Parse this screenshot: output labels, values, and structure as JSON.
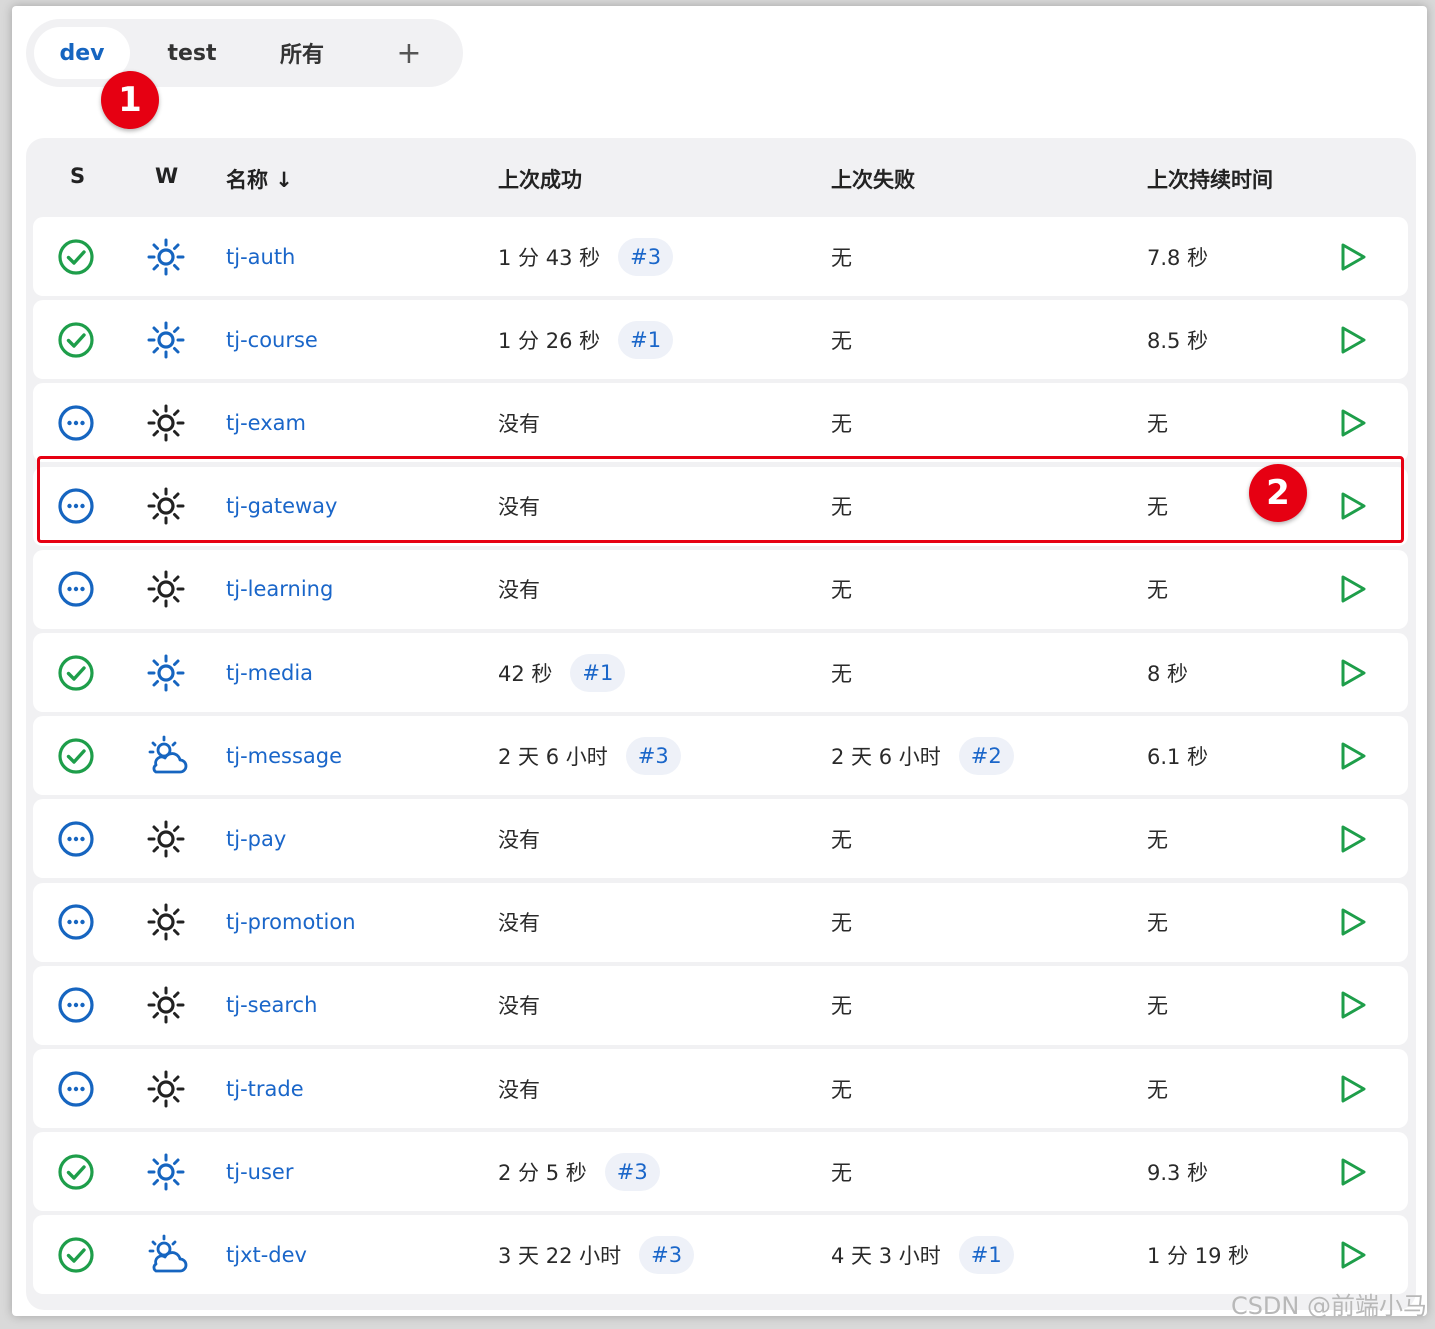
{
  "tabs": [
    {
      "label": "dev",
      "active": true
    },
    {
      "label": "test",
      "active": false
    },
    {
      "label": "所有",
      "active": false
    },
    {
      "label": "+",
      "active": false
    }
  ],
  "annotations": {
    "one": "1",
    "two": "2"
  },
  "table": {
    "headers": {
      "s": "S",
      "w": "W",
      "name": "名称 ↓",
      "last_success": "上次成功",
      "last_failure": "上次失败",
      "last_duration": "上次持续时间"
    },
    "rows": [
      {
        "status": "success",
        "weather": "sunny",
        "name": "tj-auth",
        "last_success": "1 分 43 秒",
        "success_build": "#3",
        "last_failure": "无",
        "failure_build": "",
        "duration": "7.8 秒"
      },
      {
        "status": "success",
        "weather": "sunny",
        "name": "tj-course",
        "last_success": "1 分 26 秒",
        "success_build": "#1",
        "last_failure": "无",
        "failure_build": "",
        "duration": "8.5 秒"
      },
      {
        "status": "notbuilt",
        "weather": "sunny-dark",
        "name": "tj-exam",
        "last_success": "没有",
        "success_build": "",
        "last_failure": "无",
        "failure_build": "",
        "duration": "无"
      },
      {
        "status": "notbuilt",
        "weather": "sunny-dark",
        "name": "tj-gateway",
        "last_success": "没有",
        "success_build": "",
        "last_failure": "无",
        "failure_build": "",
        "duration": "无"
      },
      {
        "status": "notbuilt",
        "weather": "sunny-dark",
        "name": "tj-learning",
        "last_success": "没有",
        "success_build": "",
        "last_failure": "无",
        "failure_build": "",
        "duration": "无"
      },
      {
        "status": "success",
        "weather": "sunny",
        "name": "tj-media",
        "last_success": "42 秒",
        "success_build": "#1",
        "last_failure": "无",
        "failure_build": "",
        "duration": "8 秒"
      },
      {
        "status": "success",
        "weather": "cloudy",
        "name": "tj-message",
        "last_success": "2 天 6 小时",
        "success_build": "#3",
        "last_failure": "2 天 6 小时",
        "failure_build": "#2",
        "duration": "6.1 秒"
      },
      {
        "status": "notbuilt",
        "weather": "sunny-dark",
        "name": "tj-pay",
        "last_success": "没有",
        "success_build": "",
        "last_failure": "无",
        "failure_build": "",
        "duration": "无"
      },
      {
        "status": "notbuilt",
        "weather": "sunny-dark",
        "name": "tj-promotion",
        "last_success": "没有",
        "success_build": "",
        "last_failure": "无",
        "failure_build": "",
        "duration": "无"
      },
      {
        "status": "notbuilt",
        "weather": "sunny-dark",
        "name": "tj-search",
        "last_success": "没有",
        "success_build": "",
        "last_failure": "无",
        "failure_build": "",
        "duration": "无"
      },
      {
        "status": "notbuilt",
        "weather": "sunny-dark",
        "name": "tj-trade",
        "last_success": "没有",
        "success_build": "",
        "last_failure": "无",
        "failure_build": "",
        "duration": "无"
      },
      {
        "status": "success",
        "weather": "sunny",
        "name": "tj-user",
        "last_success": "2 分 5 秒",
        "success_build": "#3",
        "last_failure": "无",
        "failure_build": "",
        "duration": "9.3 秒"
      },
      {
        "status": "success",
        "weather": "cloudy",
        "name": "tjxt-dev",
        "last_success": "3 天 22 小时",
        "success_build": "#3",
        "last_failure": "4 天 3 小时",
        "failure_build": "#1",
        "duration": "1 分 19 秒"
      }
    ]
  },
  "colors": {
    "success": "#1e9e4a",
    "notbuilt": "#1665c0",
    "link": "#1a66c9",
    "run": "#1e9e4a",
    "annotation": "#e60012"
  },
  "icons": {
    "status_success": "check-circle-icon",
    "status_notbuilt": "ellipsis-circle-icon",
    "weather_sunny": "sun-icon",
    "weather_cloudy": "cloud-sun-icon",
    "run": "play-icon"
  },
  "watermark": "CSDN @前端小马"
}
